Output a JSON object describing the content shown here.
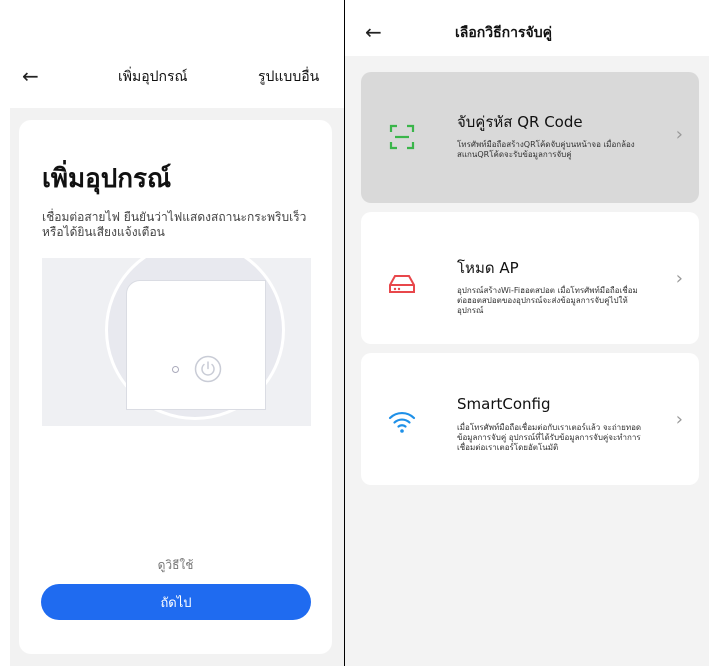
{
  "left": {
    "header": {
      "title": "เพิ่มอุปกรณ์",
      "other_mode": "รูปแบบอื่น"
    },
    "card": {
      "heading": "เพิ่มอุปกรณ์",
      "description": "เชื่อมต่อสายไฟ ยืนยันว่าไฟแสดงสถานะกระพริบเร็วหรือได้ยินเสียงแจ้งเตือน",
      "how_to_link": "ดูวิธีใช้",
      "next_button": "ถัดไป"
    }
  },
  "right": {
    "header": {
      "title": "เลือกวิธีการจับคู่"
    },
    "options": [
      {
        "name": "จับคู่รหัส QR Code",
        "description": "โทรศัพท์มือถือสร้างQRโค้ดจับคู่บนหน้าจอ เมื่อกล้องสแกนQRโค้ดจะรับข้อมูลการจับคู่",
        "icon": "qr-scan-icon",
        "icon_color": "#3ab54a",
        "selected": true
      },
      {
        "name": "โหมด AP",
        "description": "อุปกรณ์สร้างWi-Fiฮอตสปอต เมื่อโทรศัพท์มือถือเชื่อมต่อฮอตสปอตของอุปกรณ์จะส่งข้อมูลการจับคู่ไปให้อุปกรณ์",
        "icon": "router-icon",
        "icon_color": "#e8474b",
        "selected": false
      },
      {
        "name": "SmartConfig",
        "description": "เมื่อโทรศัพท์มือถือเชื่อมต่อกับเราเตอร์แล้ว จะถ่ายทอดข้อมูลการจับคู่ อุปกรณ์ที่ได้รับข้อมูลการจับคู่จะทำการเชื่อมต่อเราเตอร์โดยอัตโนมัติ",
        "icon": "wifi-icon",
        "icon_color": "#1e90e8",
        "selected": false
      }
    ]
  },
  "colors": {
    "primary_button": "#1f6bf0"
  }
}
